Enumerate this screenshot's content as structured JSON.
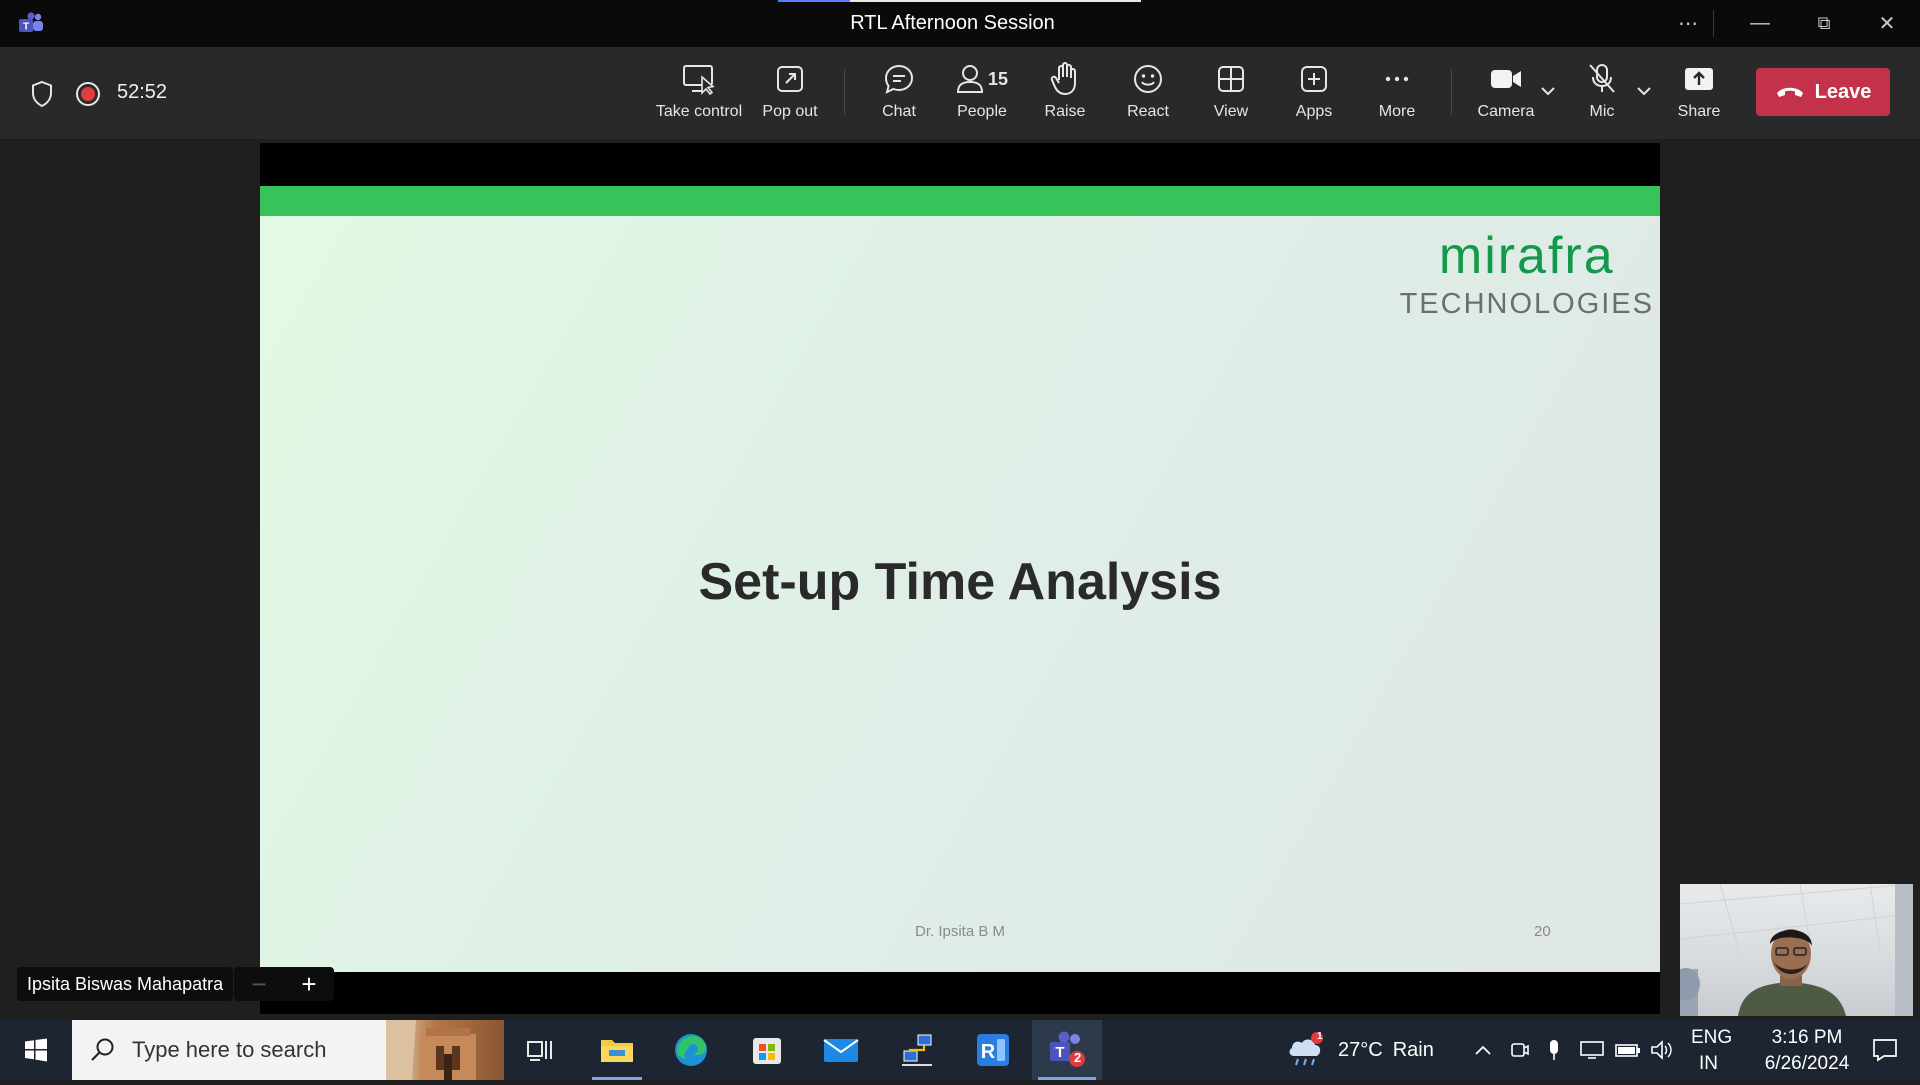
{
  "window": {
    "title": "RTL Afternoon Session",
    "more_label": "⋯",
    "minimize_label": "—",
    "restore_label": "⧉",
    "close_label": "✕"
  },
  "toolbar": {
    "timer": "52:52",
    "buttons": {
      "take_control": "Take control",
      "pop_out": "Pop out",
      "chat": "Chat",
      "people": "People",
      "people_count": "15",
      "raise": "Raise",
      "react": "React",
      "view": "View",
      "apps": "Apps",
      "more": "More",
      "camera": "Camera",
      "mic": "Mic",
      "share": "Share"
    },
    "leave_label": "Leave",
    "leave_color": "#c4314b"
  },
  "slide": {
    "brand_name": "mirafra",
    "brand_sub": "TECHNOLOGIES",
    "title": "Set-up Time Analysis",
    "footer": "Dr. Ipsita B M",
    "page_number": "20",
    "accent_color": "#37c25a"
  },
  "stage": {
    "presenter_name": "Ipsita Biswas Mahapatra",
    "zoom_out": "−",
    "zoom_in": "+"
  },
  "taskbar": {
    "search_placeholder": "Type here to search",
    "weather_temp": "27°C",
    "weather_text": "Rain",
    "weather_badge": "1",
    "teams_badge": "2",
    "language_line1": "ENG",
    "language_line2": "IN",
    "time": "3:16 PM",
    "date": "6/26/2024"
  }
}
